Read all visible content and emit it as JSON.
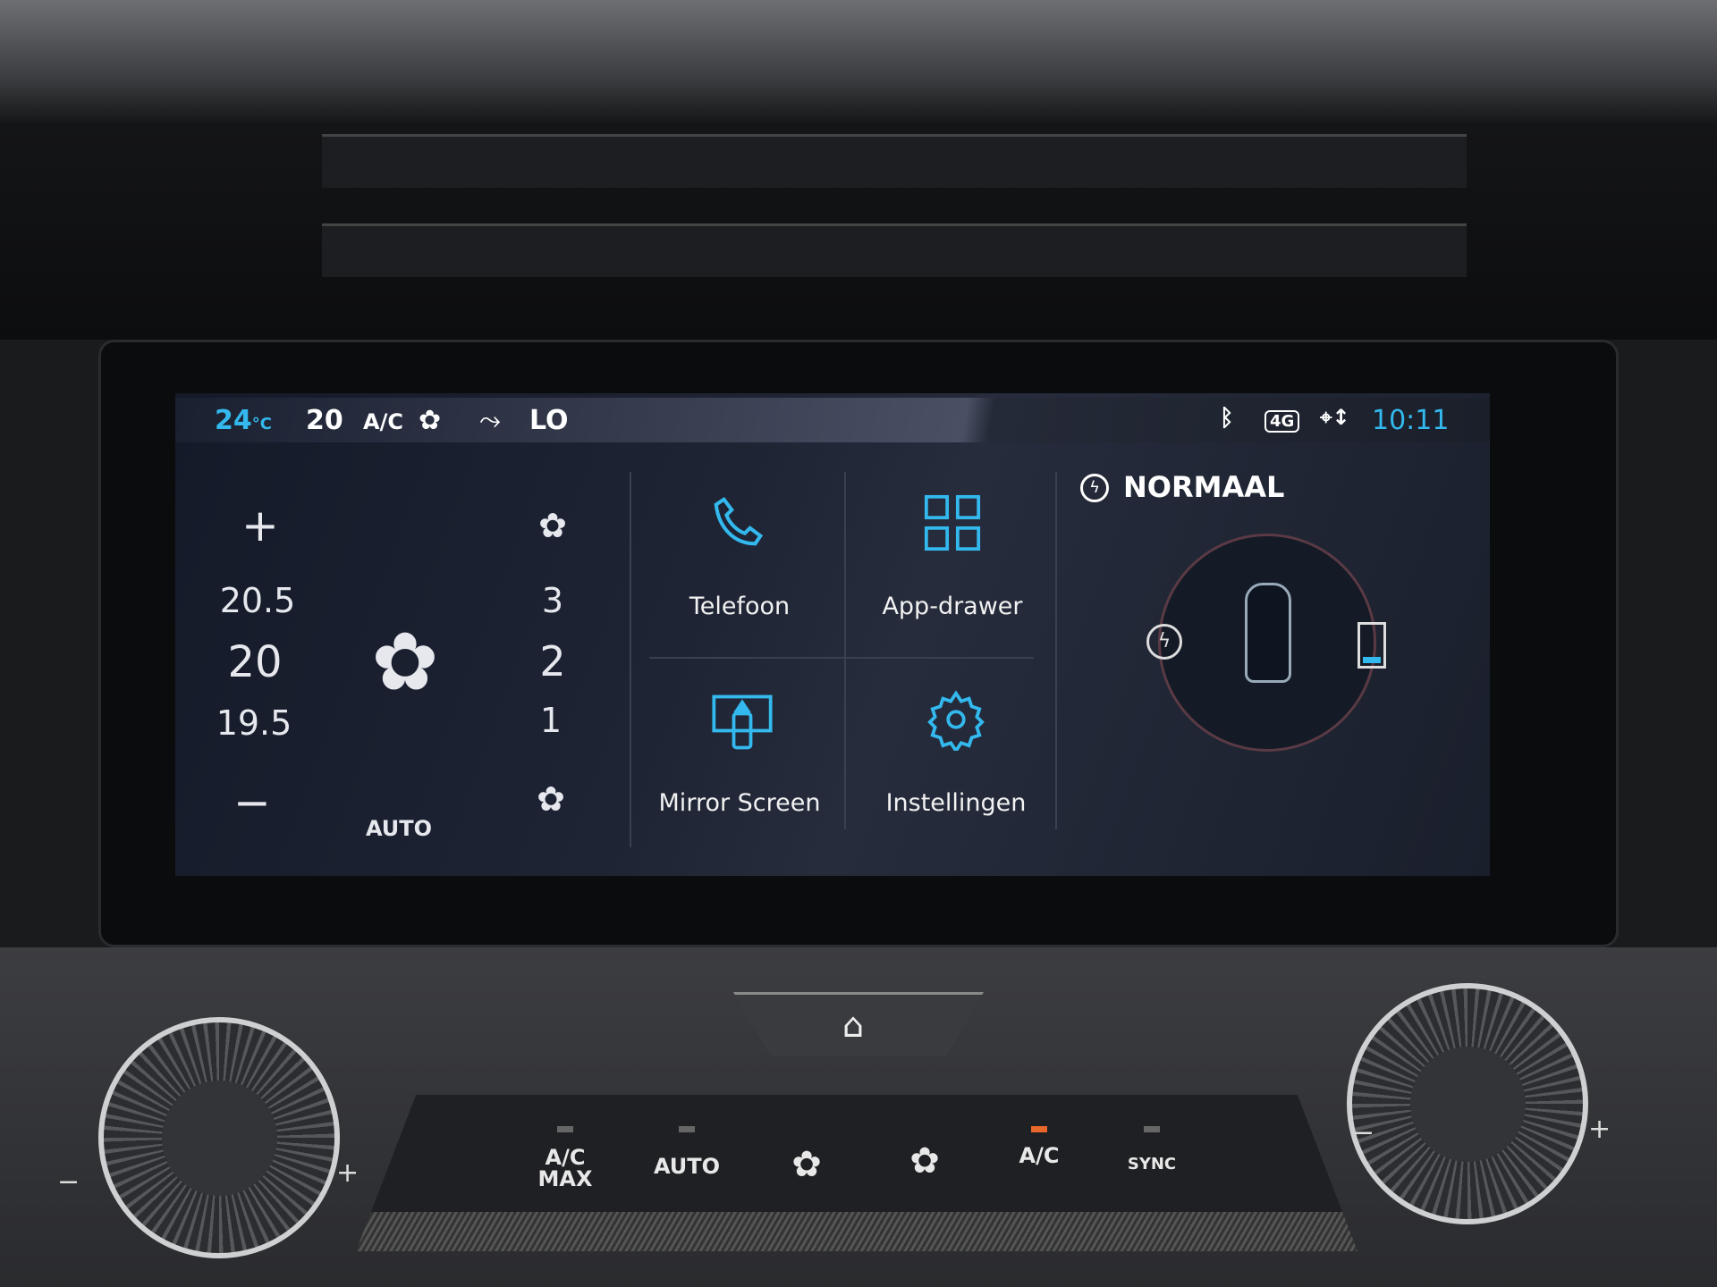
{
  "status_bar": {
    "outside_temp": "24",
    "temp_unit": "°C",
    "set_temp": "20",
    "ac_label": "A/C",
    "fan_icon": "fan-icon",
    "airflow_icon": "seat-airflow-icon",
    "fan_level": "LO",
    "clock": "10:11",
    "icons": [
      "bluetooth-icon",
      "4g-car-icon",
      "location-sync-icon"
    ]
  },
  "climate": {
    "temp_up": "+",
    "temp_above": "20.5",
    "temp_current": "20",
    "temp_below": "19.5",
    "temp_down": "−",
    "auto_label": "AUTO",
    "fan_levels": {
      "above": "3",
      "current": "2",
      "below": "1"
    }
  },
  "tiles": [
    {
      "label": "Telefoon",
      "icon": "phone-icon"
    },
    {
      "label": "App-drawer",
      "icon": "grid-icon"
    },
    {
      "label": "Mirror Screen",
      "icon": "mirror-screen-icon"
    },
    {
      "label": "Instellingen",
      "icon": "gear-icon"
    }
  ],
  "energy": {
    "mode": "NORMAAL",
    "battery_level_fraction": 0.15
  },
  "physical_buttons": {
    "ac_max_line1": "A/C",
    "ac_max_line2": "MAX",
    "auto": "AUTO",
    "ac": "A/C",
    "sync": "SYNC",
    "minus": "−",
    "plus": "+"
  },
  "colors": {
    "accent": "#33b9ee",
    "indicator_on": "#e8672a"
  }
}
